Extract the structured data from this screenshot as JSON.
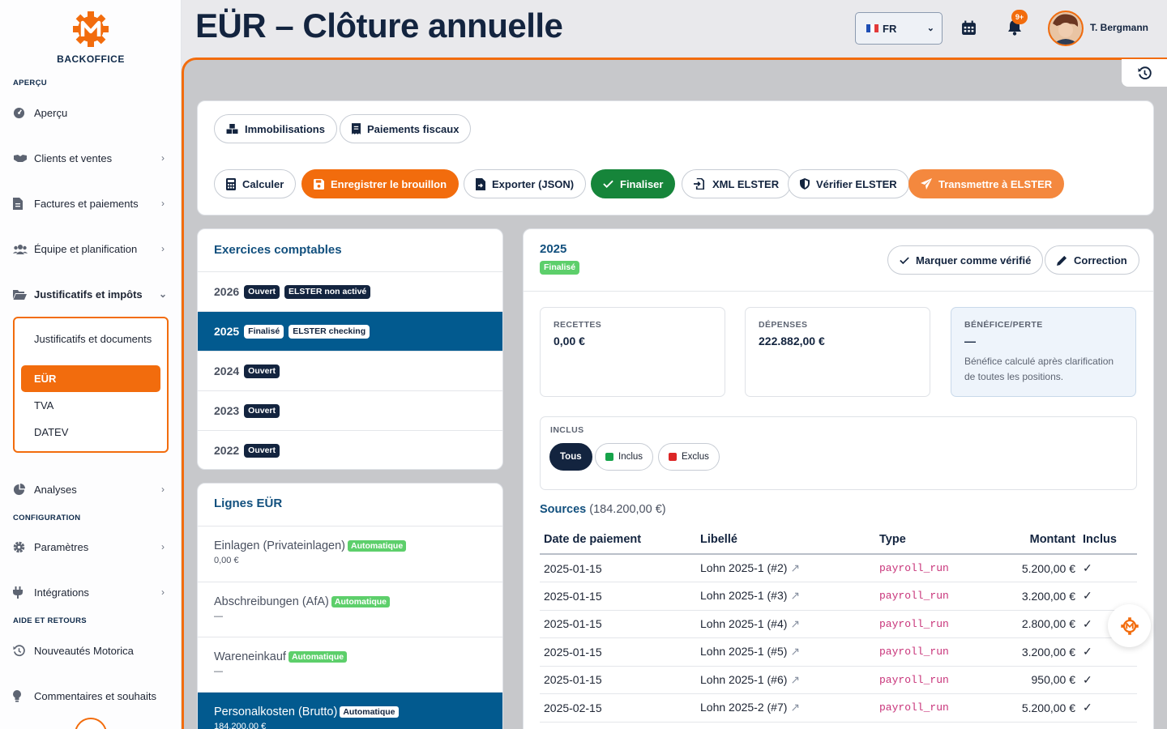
{
  "brand": {
    "name": "BACKOFFICE",
    "accent": "#f26c0d"
  },
  "sidebar": {
    "sections": {
      "overview": "APERÇU",
      "config": "CONFIGURATION",
      "help": "AIDE ET RETOURS"
    },
    "items": [
      {
        "label": "Aperçu",
        "icon": "dashboard-icon"
      },
      {
        "label": "Clients et ventes",
        "icon": "handshake-icon"
      },
      {
        "label": "Factures et paiements",
        "icon": "invoice-icon"
      },
      {
        "label": "Équipe et planification",
        "icon": "users-icon"
      },
      {
        "label": "Justificatifs et impôts",
        "icon": "folder-open-icon"
      },
      {
        "label": "Analyses",
        "icon": "pie-chart-icon"
      },
      {
        "label": "Paramètres",
        "icon": "gear-icon"
      },
      {
        "label": "Intégrations",
        "icon": "plug-icon"
      },
      {
        "label": "Nouveautés Motorica",
        "icon": "history-icon"
      },
      {
        "label": "Commentaires et souhaits",
        "icon": "lightbulb-icon"
      }
    ],
    "subitems": [
      "Justificatifs et documents",
      "EÜR",
      "TVA",
      "DATEV"
    ]
  },
  "header": {
    "title": "EÜR – Clôture annuelle",
    "language": "FR",
    "notifications": "9+",
    "user": "T. Bergmann"
  },
  "toolbar": {
    "row1": [
      "Immobilisations",
      "Paiements fiscaux"
    ],
    "row2": [
      "Calculer",
      "Enregistrer le brouillon",
      "Exporter (JSON)",
      "Finaliser",
      "XML ELSTER",
      "Vérifier ELSTER",
      "Transmettre à ELSTER"
    ]
  },
  "years": {
    "title": "Exercices comptables",
    "rows": [
      {
        "year": "2026",
        "tags": [
          "Ouvert",
          "ELSTER non activé"
        ]
      },
      {
        "year": "2025",
        "tags": [
          "Finalisé",
          "ELSTER checking"
        ]
      },
      {
        "year": "2024",
        "tags": [
          "Ouvert"
        ]
      },
      {
        "year": "2023",
        "tags": [
          "Ouvert"
        ]
      },
      {
        "year": "2022",
        "tags": [
          "Ouvert"
        ]
      }
    ]
  },
  "lines": {
    "title": "Lignes EÜR",
    "auto_label": "Automatique",
    "rows": [
      {
        "name": "Einlagen (Privateinlagen)",
        "value": "0,00 €"
      },
      {
        "name": "Abschreibungen (AfA)",
        "value": "—"
      },
      {
        "name": "Wareneinkauf",
        "value": "—"
      },
      {
        "name": "Personalkosten (Brutto)",
        "value": "184.200,00 €"
      }
    ]
  },
  "detail": {
    "year": "2025",
    "status": "Finalisé",
    "mark_verified": "Marquer comme vérifié",
    "correction": "Correction",
    "stats": [
      {
        "key": "RECETTES",
        "value": "0,00 €",
        "desc": ""
      },
      {
        "key": "DÉPENSES",
        "value": "222.882,00 €",
        "desc": ""
      },
      {
        "key": "BÉNÉFICE/PERTE",
        "value": "—",
        "desc": "Bénéfice calculé après clarification de toutes les positions."
      }
    ],
    "filter": {
      "title": "INCLUS",
      "options": [
        "Tous",
        "Inclus",
        "Exclus"
      ],
      "colors": [
        "#16a34a",
        "#dc2626"
      ]
    },
    "sources_label": "Sources",
    "sources_total": "(184.200,00 €)",
    "columns": [
      "Date de paiement",
      "Libellé",
      "Type",
      "Montant",
      "Inclus"
    ],
    "rows": [
      {
        "date": "2025-01-15",
        "label": "Lohn 2025-1 (#2)",
        "type": "payroll_run",
        "amount": "5.200,00 €",
        "incl": "✓"
      },
      {
        "date": "2025-01-15",
        "label": "Lohn 2025-1 (#3)",
        "type": "payroll_run",
        "amount": "3.200,00 €",
        "incl": "✓"
      },
      {
        "date": "2025-01-15",
        "label": "Lohn 2025-1 (#4)",
        "type": "payroll_run",
        "amount": "2.800,00 €",
        "incl": "✓"
      },
      {
        "date": "2025-01-15",
        "label": "Lohn 2025-1 (#5)",
        "type": "payroll_run",
        "amount": "3.200,00 €",
        "incl": "✓"
      },
      {
        "date": "2025-01-15",
        "label": "Lohn 2025-1 (#6)",
        "type": "payroll_run",
        "amount": "950,00 €",
        "incl": "✓"
      },
      {
        "date": "2025-02-15",
        "label": "Lohn 2025-2 (#7)",
        "type": "payroll_run",
        "amount": "5.200,00 €",
        "incl": "✓"
      }
    ]
  }
}
